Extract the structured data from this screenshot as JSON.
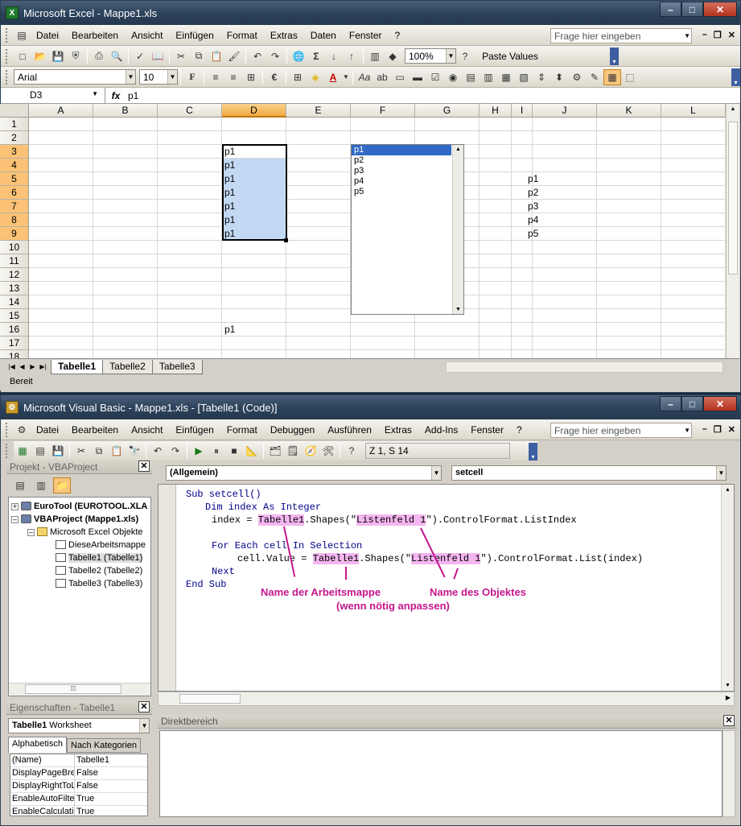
{
  "excel": {
    "title": "Microsoft Excel - Mappe1.xls",
    "menu": [
      "Datei",
      "Bearbeiten",
      "Ansicht",
      "Einfügen",
      "Format",
      "Extras",
      "Daten",
      "Fenster",
      "?"
    ],
    "ask_placeholder": "Frage hier eingeben",
    "zoom": "100%",
    "paste_values": "Paste Values",
    "font": "Arial",
    "font_size": "10",
    "namebox": "D3",
    "fx": "fx",
    "formula": "p1",
    "columns": [
      "A",
      "B",
      "C",
      "D",
      "E",
      "F",
      "G",
      "H",
      "I",
      "J",
      "K",
      "L"
    ],
    "rows": [
      "1",
      "2",
      "3",
      "4",
      "5",
      "6",
      "7",
      "8",
      "9",
      "10",
      "11",
      "12",
      "13",
      "14",
      "15",
      "16",
      "17",
      "18"
    ],
    "cells_d": [
      "p1",
      "p1",
      "p1",
      "p1",
      "p1",
      "p1",
      "p1"
    ],
    "cell_d16": "p1",
    "cells_j": [
      "p1",
      "p2",
      "p3",
      "p4",
      "p5"
    ],
    "listbox": [
      "p1",
      "p2",
      "p3",
      "p4",
      "p5"
    ],
    "sheets": [
      "Tabelle1",
      "Tabelle2",
      "Tabelle3"
    ],
    "status": "Bereit"
  },
  "vb": {
    "title": "Microsoft Visual Basic - Mappe1.xls - [Tabelle1 (Code)]",
    "menu": [
      "Datei",
      "Bearbeiten",
      "Ansicht",
      "Einfügen",
      "Format",
      "Debuggen",
      "Ausführen",
      "Extras",
      "Add-Ins",
      "Fenster",
      "?"
    ],
    "ask_placeholder": "Frage hier eingeben",
    "position": "Z 1, S 14",
    "project_title": "Projekt - VBAProject",
    "tree": {
      "eurotool": "EuroTool (EUROTOOL.XLA",
      "vbaproject": "VBAProject (Mappe1.xls)",
      "objects": "Microsoft Excel Objekte",
      "items": [
        "DieseArbeitsmappe",
        "Tabelle1 (Tabelle1)",
        "Tabelle2 (Tabelle2)",
        "Tabelle3 (Tabelle3)"
      ]
    },
    "props_title": "Eigenschaften - Tabelle1",
    "props_object": "Tabelle1",
    "props_object_type": "Worksheet",
    "props_tabs": [
      "Alphabetisch",
      "Nach Kategorien"
    ],
    "props": [
      [
        "(Name)",
        "Tabelle1"
      ],
      [
        "DisplayPageBrea",
        "False"
      ],
      [
        "DisplayRightToL",
        "False"
      ],
      [
        "EnableAutoFilter",
        "True"
      ],
      [
        "EnableCalculatio",
        "True"
      ]
    ],
    "combo_object": "(Allgemein)",
    "combo_proc": "setcell",
    "immediate_title": "Direktbereich",
    "code": {
      "l1": "Sub setcell()",
      "l2": "Dim index As Integer",
      "l3a": "index = ",
      "l3b": "Tabelle1",
      "l3c": ".Shapes(\"",
      "l3d": "Listenfeld 1",
      "l3e": "\").ControlFormat.ListIndex",
      "l4": "For Each cell In Selection",
      "l5a": "cell.Value = ",
      "l5b": "Tabelle1",
      "l5c": ".Shapes(\"",
      "l5d": "Listenfeld 1",
      "l5e": "\").ControlFormat.List(index)",
      "l6": "Next",
      "l7": "End Sub"
    },
    "annotations": {
      "a1": "Name der Arbeitsmappe",
      "a2": "(wenn nötig anpassen)",
      "a3": "Name des Objektes"
    }
  },
  "colors": {
    "highlight": "#f4b6f0",
    "annotation": "#c4168d",
    "selection": "#c3d9f3"
  }
}
